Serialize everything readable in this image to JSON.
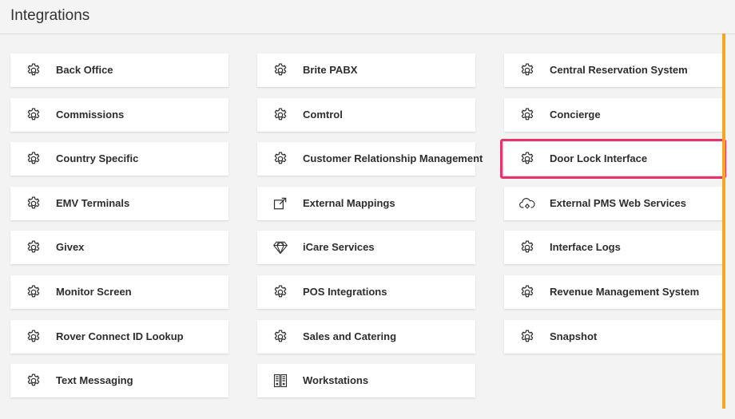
{
  "header": {
    "title": "Integrations"
  },
  "colors": {
    "accent": "#f5a623",
    "highlight": "#e9326a"
  },
  "columns": [
    [
      {
        "label": "Back Office",
        "icon": "gear-icon"
      },
      {
        "label": "Commissions",
        "icon": "gear-icon"
      },
      {
        "label": "Country Specific",
        "icon": "gear-icon"
      },
      {
        "label": "EMV Terminals",
        "icon": "gear-icon"
      },
      {
        "label": "Givex",
        "icon": "gear-icon"
      },
      {
        "label": "Monitor Screen",
        "icon": "gear-icon"
      },
      {
        "label": "Rover Connect ID Lookup",
        "icon": "gear-icon"
      },
      {
        "label": "Text Messaging",
        "icon": "gear-icon"
      }
    ],
    [
      {
        "label": "Brite PABX",
        "icon": "gear-icon"
      },
      {
        "label": "Comtrol",
        "icon": "gear-icon"
      },
      {
        "label": "Customer Relationship Management",
        "icon": "gear-icon"
      },
      {
        "label": "External Mappings",
        "icon": "external-link-icon"
      },
      {
        "label": "iCare Services",
        "icon": "diamond-icon"
      },
      {
        "label": "POS Integrations",
        "icon": "gear-icon"
      },
      {
        "label": "Sales and Catering",
        "icon": "gear-icon"
      },
      {
        "label": "Workstations",
        "icon": "workstation-icon"
      }
    ],
    [
      {
        "label": "Central Reservation System",
        "icon": "gear-icon"
      },
      {
        "label": "Concierge",
        "icon": "gear-icon"
      },
      {
        "label": "Door Lock Interface",
        "icon": "gear-icon",
        "highlighted": true
      },
      {
        "label": "External PMS Web Services",
        "icon": "cloud-gear-icon"
      },
      {
        "label": "Interface Logs",
        "icon": "gear-icon"
      },
      {
        "label": "Revenue Management System",
        "icon": "gear-icon"
      },
      {
        "label": "Snapshot",
        "icon": "gear-icon"
      }
    ]
  ]
}
